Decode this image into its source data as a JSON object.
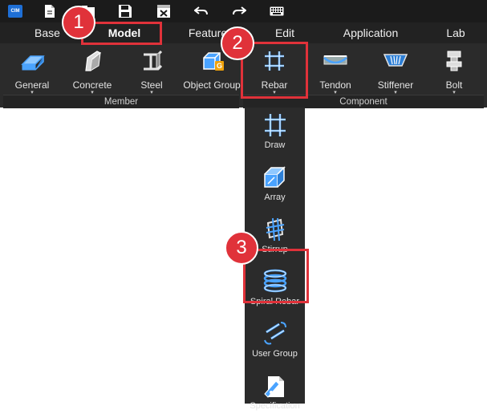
{
  "quick_access": {
    "logo_text": "CIM",
    "icons": [
      "app-logo-icon",
      "new-file-icon",
      "open-file-icon",
      "save-icon",
      "close-file-icon",
      "undo-icon",
      "redo-icon",
      "keyboard-icon"
    ]
  },
  "tabs": [
    {
      "label": "Base"
    },
    {
      "label": "Model",
      "active": true
    },
    {
      "label": "Feature"
    },
    {
      "label": "Edit"
    },
    {
      "label": "Application"
    },
    {
      "label": "Lab"
    }
  ],
  "ribbon": {
    "buttons": [
      {
        "label": "General",
        "dropdown_arrow": "▾"
      },
      {
        "label": "Concrete",
        "dropdown_arrow": "▾"
      },
      {
        "label": "Steel",
        "dropdown_arrow": "▾"
      },
      {
        "label": "Object Group",
        "badge_letter": "G"
      },
      {
        "label": "Rebar",
        "dropdown_arrow": "▾"
      },
      {
        "label": "Tendon",
        "dropdown_arrow": "▾"
      },
      {
        "label": "Stiffener",
        "dropdown_arrow": "▾"
      },
      {
        "label": "Bolt",
        "dropdown_arrow": "▾"
      }
    ],
    "groups": [
      {
        "label": "Member"
      },
      {
        "label": "Component"
      }
    ]
  },
  "rebar_menu": {
    "items": [
      {
        "label": "Draw"
      },
      {
        "label": "Array"
      },
      {
        "label": "Stirrup"
      },
      {
        "label": "Spiral Rebar"
      },
      {
        "label": "User Group"
      },
      {
        "label": "Specification"
      }
    ]
  },
  "callouts": [
    "1",
    "2",
    "3"
  ],
  "colors": {
    "callout_red": "#e0323a",
    "icon_blue": "#4aa3ff",
    "ribbon_bg": "#2b2b2b",
    "badge_orange": "#f0a20a"
  }
}
